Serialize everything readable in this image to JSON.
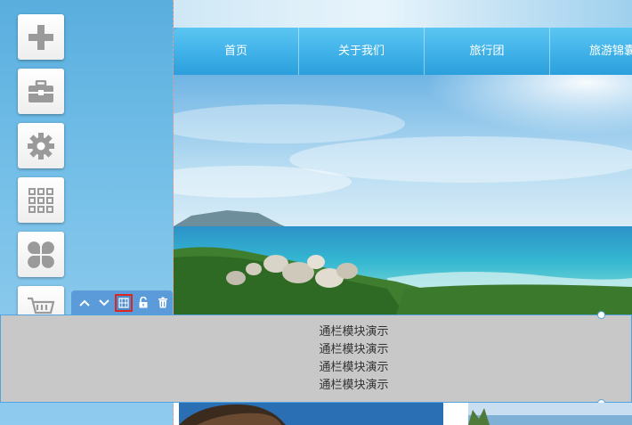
{
  "nav": {
    "items": [
      "首页",
      "关于我们",
      "旅行团",
      "旅游锦囊"
    ]
  },
  "toolbar": {
    "tools": [
      {
        "icon": "add-icon"
      },
      {
        "icon": "toolbox-icon"
      },
      {
        "icon": "gear-icon"
      },
      {
        "icon": "grid-icon"
      },
      {
        "icon": "clover-icon"
      },
      {
        "icon": "cart-icon"
      }
    ]
  },
  "module_bar": {
    "buttons": [
      "move-up-icon",
      "move-down-icon",
      "column-settings-icon",
      "unlock-icon",
      "delete-icon"
    ],
    "selected": "column-settings-icon"
  },
  "module": {
    "lines": [
      "通栏模块演示",
      "通栏模块演示",
      "通栏模块演示",
      "通栏模块演示"
    ]
  },
  "colors": {
    "nav": "#3fb1e8",
    "module_bg": "#c8c8c8",
    "selection": "#4ea3e0",
    "highlight": "#e0261c"
  }
}
